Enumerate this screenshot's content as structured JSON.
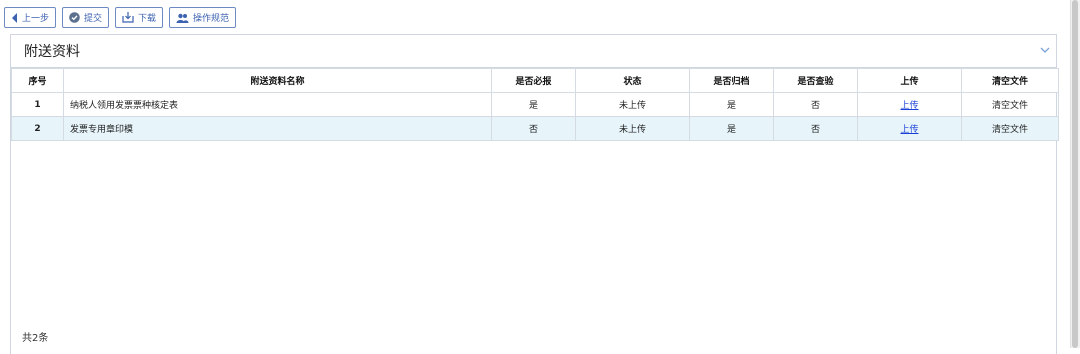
{
  "toolbar": {
    "prev_label": "上一步",
    "submit_label": "提交",
    "download_label": "下载",
    "guide_label": "操作规范"
  },
  "panel": {
    "title": "附送资料"
  },
  "table": {
    "headers": [
      "序号",
      "附送资料名称",
      "是否必报",
      "状态",
      "是否归档",
      "是否查验",
      "上传",
      "清空文件"
    ],
    "rows": [
      {
        "no": "1",
        "name": "纳税人领用发票票种核定表",
        "required": "是",
        "status": "未上传",
        "archived": "是",
        "verified": "否",
        "upload": "上传",
        "clear": "清空文件"
      },
      {
        "no": "2",
        "name": "发票专用章印模",
        "required": "否",
        "status": "未上传",
        "archived": "是",
        "verified": "否",
        "upload": "上传",
        "clear": "清空文件"
      }
    ]
  },
  "footer": {
    "total": "共2条"
  },
  "colors": {
    "accent": "#3c62b0",
    "link": "#1a3fd6",
    "selected_row": "#e7f5fb"
  },
  "icons": [
    "back-arrow-icon",
    "check-circle-icon",
    "download-tray-icon",
    "users-icon",
    "chevron-down-icon"
  ]
}
